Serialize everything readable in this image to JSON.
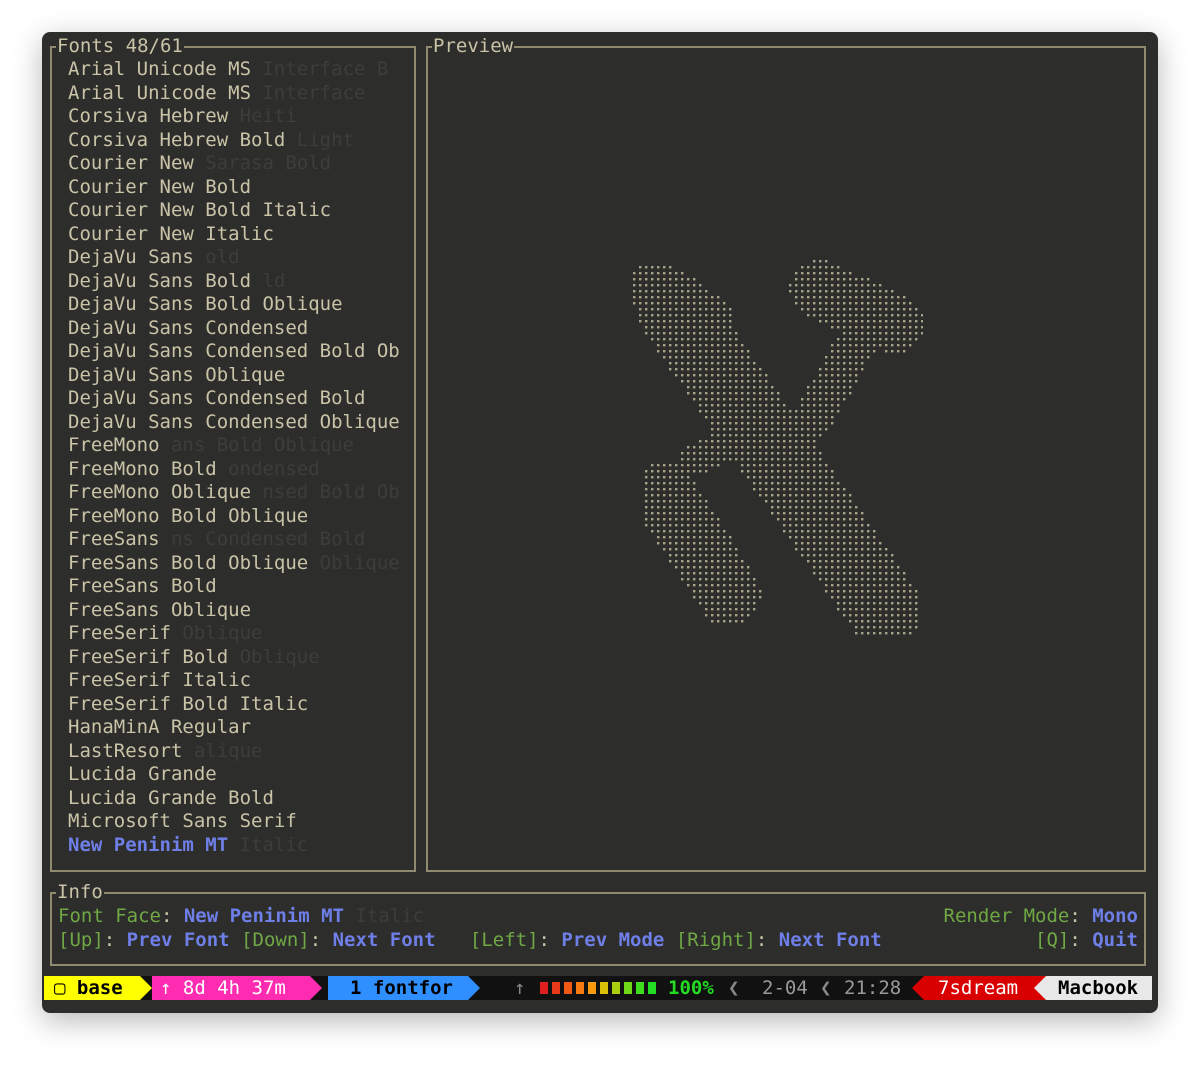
{
  "fonts_pane": {
    "title": "Fonts 48/61",
    "items": [
      {
        "name": "Arial Unicode MS",
        "ghost": " Interface B"
      },
      {
        "name": "Arial Unicode MS",
        "ghost": " Interface"
      },
      {
        "name": "Corsiva Hebrew",
        "ghost": " Heiti"
      },
      {
        "name": "Corsiva Hebrew Bold",
        "ghost": " Light"
      },
      {
        "name": "Courier New",
        "ghost": " Sarasa Bold"
      },
      {
        "name": "Courier New Bold",
        "ghost": ""
      },
      {
        "name": "Courier New Bold Italic",
        "ghost": ""
      },
      {
        "name": "Courier New Italic",
        "ghost": ""
      },
      {
        "name": "DejaVu Sans",
        "ghost": " old"
      },
      {
        "name": "DejaVu Sans Bold",
        "ghost": " ld"
      },
      {
        "name": "DejaVu Sans Bold Oblique",
        "ghost": ""
      },
      {
        "name": "DejaVu Sans Condensed",
        "ghost": ""
      },
      {
        "name": "DejaVu Sans Condensed Bold Ob",
        "ghost": ""
      },
      {
        "name": "DejaVu Sans Oblique",
        "ghost": ""
      },
      {
        "name": "DejaVu Sans Condensed Bold",
        "ghost": ""
      },
      {
        "name": "DejaVu Sans Condensed Oblique",
        "ghost": ""
      },
      {
        "name": "FreeMono",
        "ghost": " ans Bold Oblique"
      },
      {
        "name": "FreeMono Bold",
        "ghost": " ondensed"
      },
      {
        "name": "FreeMono Oblique",
        "ghost": " nsed Bold Ob"
      },
      {
        "name": "FreeMono Bold Oblique",
        "ghost": ""
      },
      {
        "name": "FreeSans",
        "ghost": " ns Condensed Bold"
      },
      {
        "name": "FreeSans Bold Oblique",
        "ghost": " Oblique"
      },
      {
        "name": "FreeSans Bold",
        "ghost": ""
      },
      {
        "name": "FreeSans Oblique",
        "ghost": ""
      },
      {
        "name": "FreeSerif",
        "ghost": " Oblique"
      },
      {
        "name": "FreeSerif Bold",
        "ghost": " Oblique"
      },
      {
        "name": "FreeSerif Italic",
        "ghost": ""
      },
      {
        "name": "FreeSerif Bold Italic",
        "ghost": ""
      },
      {
        "name": "HanaMinA Regular",
        "ghost": ""
      },
      {
        "name": "LastResort",
        "ghost": " alique"
      },
      {
        "name": "Lucida Grande",
        "ghost": ""
      },
      {
        "name": "Lucida Grande Bold",
        "ghost": ""
      },
      {
        "name": "Microsoft Sans Serif",
        "ghost": ""
      },
      {
        "name": "New Peninim MT",
        "ghost": " Italic",
        "selected": true
      }
    ]
  },
  "preview_pane": {
    "title": "Preview",
    "glyph_color": "#a8a48a"
  },
  "info_pane": {
    "title": "Info",
    "font_face_label": "Font Face",
    "font_face_value": "New Peninim MT",
    "font_face_ghost": " Italic",
    "render_mode_label": "Render Mode",
    "render_mode_value": "Mono",
    "keys": [
      {
        "key": "[Up]",
        "action": "Prev Font"
      },
      {
        "key": "[Down]",
        "action": "Next Font"
      },
      {
        "key": "[Left]",
        "action": "Prev Mode"
      },
      {
        "key": "[Right]",
        "action": "Next Font"
      }
    ],
    "quit_key": "[Q]",
    "quit_action": "Quit"
  },
  "status_bar": {
    "session": "▢ base",
    "uptime": "↑ 8d 4h 37m",
    "window": "1 fontfor",
    "battery_arrow": "↑",
    "battery_pct": "100%",
    "date": "2-04",
    "time": "21:28",
    "user": "7sdream",
    "host": "Macbook",
    "colors": {
      "session_bg": "#ffff00",
      "uptime_bg": "#ff2bb0",
      "window_bg": "#2f8fff",
      "user_bg": "#d80000",
      "host_bg": "#e8e8e8",
      "battery_full": "#22dd22"
    }
  }
}
